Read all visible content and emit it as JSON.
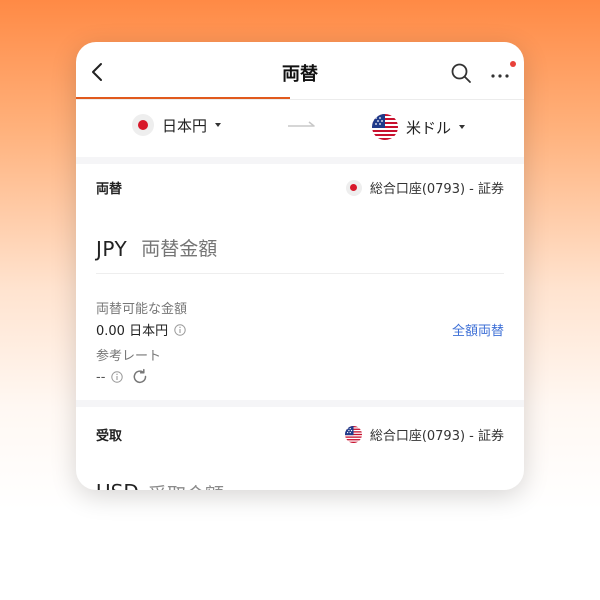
{
  "header": {
    "title": "両替"
  },
  "currencies": {
    "from": {
      "label": "日本円"
    },
    "to": {
      "label": "米ドル"
    }
  },
  "exchange": {
    "title": "両替",
    "account": "総合口座(0793) - 証券",
    "currency_code": "JPY",
    "amount_placeholder": "両替金額",
    "available_label": "両替可能な金額",
    "available_value": "0.00 日本円",
    "full_button": "全額両替",
    "rate_label": "参考レート",
    "rate_value": "--"
  },
  "receive": {
    "title": "受取",
    "account": "総合口座(0793) - 証券",
    "currency_code": "USD",
    "amount_placeholder": "受取金額"
  },
  "colors": {
    "accent": "#e15a1d",
    "link": "#3d6fd6",
    "alert_dot": "#e8403a"
  }
}
